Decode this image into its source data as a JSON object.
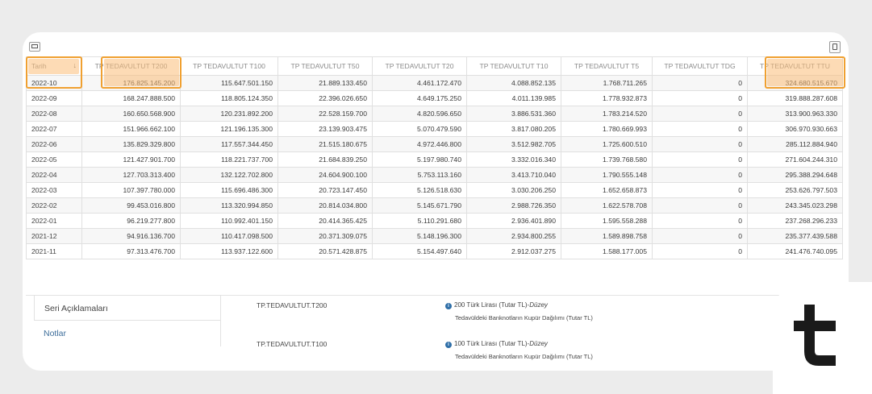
{
  "table": {
    "columns": [
      "Tarih",
      "TP TEDAVULTUT T200",
      "TP TEDAVULTUT T100",
      "TP TEDAVULTUT T50",
      "TP TEDAVULTUT T20",
      "TP TEDAVULTUT T10",
      "TP TEDAVULTUT T5",
      "TP TEDAVULTUT TDG",
      "TP TEDAVULTUT TTU"
    ],
    "sort_indicator": "↓",
    "rows": [
      [
        "2022-10",
        "176.825.145.200",
        "115.647.501.150",
        "21.889.133.450",
        "4.461.172.470",
        "4.088.852.135",
        "1.768.711.265",
        "0",
        "324.680.515.670"
      ],
      [
        "2022-09",
        "168.247.888.500",
        "118.805.124.350",
        "22.396.026.650",
        "4.649.175.250",
        "4.011.139.985",
        "1.778.932.873",
        "0",
        "319.888.287.608"
      ],
      [
        "2022-08",
        "160.650.568.900",
        "120.231.892.200",
        "22.528.159.700",
        "4.820.596.650",
        "3.886.531.360",
        "1.783.214.520",
        "0",
        "313.900.963.330"
      ],
      [
        "2022-07",
        "151.966.662.100",
        "121.196.135.300",
        "23.139.903.475",
        "5.070.479.590",
        "3.817.080.205",
        "1.780.669.993",
        "0",
        "306.970.930.663"
      ],
      [
        "2022-06",
        "135.829.329.800",
        "117.557.344.450",
        "21.515.180.675",
        "4.972.446.800",
        "3.512.982.705",
        "1.725.600.510",
        "0",
        "285.112.884.940"
      ],
      [
        "2022-05",
        "121.427.901.700",
        "118.221.737.700",
        "21.684.839.250",
        "5.197.980.740",
        "3.332.016.340",
        "1.739.768.580",
        "0",
        "271.604.244.310"
      ],
      [
        "2022-04",
        "127.703.313.400",
        "132.122.702.800",
        "24.604.900.100",
        "5.753.113.160",
        "3.413.710.040",
        "1.790.555.148",
        "0",
        "295.388.294.648"
      ],
      [
        "2022-03",
        "107.397.780.000",
        "115.696.486.300",
        "20.723.147.450",
        "5.126.518.630",
        "3.030.206.250",
        "1.652.658.873",
        "0",
        "253.626.797.503"
      ],
      [
        "2022-02",
        "99.453.016.800",
        "113.320.994.850",
        "20.814.034.800",
        "5.145.671.790",
        "2.988.726.350",
        "1.622.578.708",
        "0",
        "243.345.023.298"
      ],
      [
        "2022-01",
        "96.219.277.800",
        "110.992.401.150",
        "20.414.365.425",
        "5.110.291.680",
        "2.936.401.890",
        "1.595.558.288",
        "0",
        "237.268.296.233"
      ],
      [
        "2021-12",
        "94.916.136.700",
        "110.417.098.500",
        "20.371.309.075",
        "5.148.196.300",
        "2.934.800.255",
        "1.589.898.758",
        "0",
        "235.377.439.588"
      ],
      [
        "2021-11",
        "97.313.476.700",
        "113.937.122.600",
        "20.571.428.875",
        "5.154.497.640",
        "2.912.037.275",
        "1.588.177.005",
        "0",
        "241.476.740.095"
      ]
    ]
  },
  "tabs": {
    "series_desc": "Seri Açıklamaları",
    "notes": "Notlar"
  },
  "descriptions": [
    {
      "code": "TP.TEDAVULTUT.T200",
      "title_main": "200 Türk Lirası (Tutar TL)-",
      "title_italic": "Düzey",
      "subtitle": "Tedavüldeki Banknotların Kupür Dağılımı (Tutar TL)"
    },
    {
      "code": "TP.TEDAVULTUT.T100",
      "title_main": "100 Türk Lirası (Tutar TL)-",
      "title_italic": "Düzey",
      "subtitle": "Tedavüldeki Banknotların Kupür Dağılımı (Tutar TL)"
    }
  ],
  "icons": {
    "toolbar_left": "panel-toggle-icon",
    "toolbar_right": "excel-export-icon",
    "info": "info-icon",
    "logo": "brand-logo-icon"
  },
  "colors": {
    "highlight": "#f0a030",
    "link": "#3c6d9a",
    "logo": "#1a1a1a"
  }
}
